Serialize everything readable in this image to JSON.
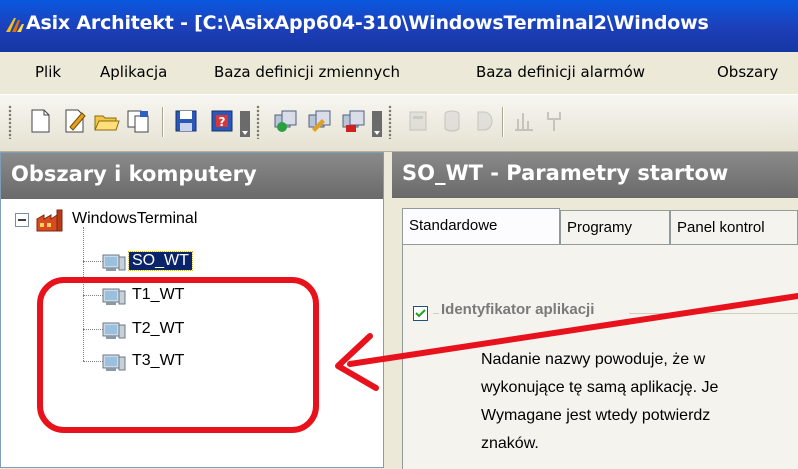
{
  "window": {
    "title": "Asix Architekt - [C:\\AsixApp604-310\\WindowsTerminal2\\Windows"
  },
  "menu": {
    "items": [
      "Plik",
      "Aplikacja",
      "Baza definicji zmiennych",
      "Baza definicji alarmów",
      "Obszary"
    ]
  },
  "left_panel": {
    "title": "Obszary i komputery",
    "tree": {
      "root": "WindowsTerminal",
      "children": [
        "SO_WT",
        "T1_WT",
        "T2_WT",
        "T3_WT"
      ],
      "selected": "SO_WT"
    }
  },
  "right_panel": {
    "title": "SO_WT - Parametry startow",
    "tabs": [
      "Standardowe",
      "Programy",
      "Panel kontrol"
    ],
    "active_tab": "Standardowe",
    "group_title": "Identyfikator aplikacji",
    "checkbox_checked": true,
    "description_lines": [
      "Nadanie nazwy powoduje, że w",
      "wykonujące tę samą aplikację. Je",
      "Wymagane jest wtedy potwierdz",
      "znaków."
    ]
  },
  "colors": {
    "titlebar": "#1d3fb8",
    "panel_header": "#7a7a7a",
    "selection": "#0a246a",
    "annotation": "#e8121c"
  },
  "icons": [
    "app-icon",
    "new-doc-icon",
    "edit-icon",
    "open-folder-icon",
    "copy-icon",
    "save-icon",
    "help-icon",
    "computer-add-icon",
    "computer-edit-icon",
    "computer-delete-icon",
    "database-icon",
    "cylinder-icon",
    "shape-icon",
    "chart-icon",
    "fork-icon"
  ]
}
